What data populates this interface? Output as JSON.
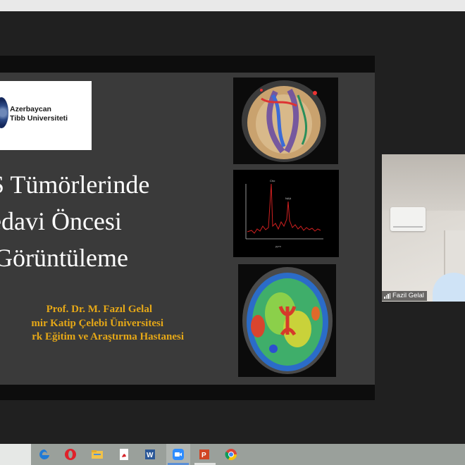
{
  "slide": {
    "logo": {
      "line1": "Azerbaycan",
      "line2": "Tibb Universiteti"
    },
    "title_lines": [
      "S Tümörlerinde",
      "edavi Öncesi",
      "Görüntüleme"
    ],
    "credit_lines": [
      "Prof. Dr. M. Fazıl Gelal",
      "mir Katip Çelebi Üniversitesi",
      "rk Eğitim ve Araştırma Hastanesi"
    ],
    "images": [
      "brain-tractography",
      "mr-spectroscopy-plot",
      "brain-perfusion-map"
    ]
  },
  "participant": {
    "name": "Fazil Gelal"
  },
  "taskbar": {
    "apps": [
      "edge-icon",
      "opera-icon",
      "file-explorer-icon",
      "acrobat-icon",
      "word-icon",
      "zoom-icon",
      "powerpoint-icon",
      "chrome-icon"
    ],
    "active_app": "zoom-icon"
  },
  "colors": {
    "slide_bg": "#3a3a3a",
    "title": "#ffffff",
    "credits": "#e6a817",
    "taskbar": "#9aa09b"
  }
}
